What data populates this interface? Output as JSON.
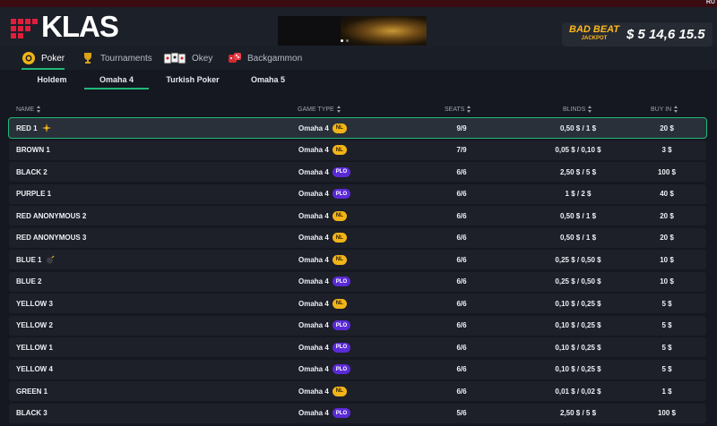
{
  "top_bar": {
    "language": "RU"
  },
  "header": {
    "logo_text": "KLAS",
    "jackpot": {
      "title": "BAD BEAT",
      "subtitle": "JACKPOT",
      "amount": "$ 5 14,6 15.5"
    }
  },
  "categories": [
    {
      "label": "Poker",
      "icon": "chips-icon",
      "active": true
    },
    {
      "label": "Tournaments",
      "icon": "trophy-icon",
      "active": false
    },
    {
      "label": "Okey",
      "icon": "okey-tiles-icon",
      "active": false
    },
    {
      "label": "Backgammon",
      "icon": "dice-icon",
      "active": false
    }
  ],
  "subtabs": [
    {
      "label": "Holdem",
      "active": false
    },
    {
      "label": "Omaha 4",
      "active": true
    },
    {
      "label": "Turkish Poker",
      "active": false
    },
    {
      "label": "Omaha 5",
      "active": false
    }
  ],
  "table": {
    "columns": {
      "name": "NAME",
      "game_type": "GAME TYPE",
      "seats": "SEATS",
      "blinds": "BLINDS",
      "buy_in": "BUY IN"
    },
    "rows": [
      {
        "name": "RED 1",
        "game": "Omaha 4",
        "limit": "NL",
        "seats": "9/9",
        "blinds": "0,50 $ / 1 $",
        "buy_in": "20 $",
        "icon": "sparkle-icon",
        "selected": true
      },
      {
        "name": "BROWN 1",
        "game": "Omaha 4",
        "limit": "NL",
        "seats": "7/9",
        "blinds": "0,05 $ / 0,10 $",
        "buy_in": "3 $"
      },
      {
        "name": "BLACK 2",
        "game": "Omaha 4",
        "limit": "PLO",
        "seats": "6/6",
        "blinds": "2,50 $ / 5 $",
        "buy_in": "100 $"
      },
      {
        "name": "PURPLE 1",
        "game": "Omaha 4",
        "limit": "PLO",
        "seats": "6/6",
        "blinds": "1 $ / 2 $",
        "buy_in": "40 $"
      },
      {
        "name": "RED ANONYMOUS 2",
        "game": "Omaha 4",
        "limit": "NL",
        "seats": "6/6",
        "blinds": "0,50 $ / 1 $",
        "buy_in": "20 $"
      },
      {
        "name": "RED ANONYMOUS 3",
        "game": "Omaha 4",
        "limit": "NL",
        "seats": "6/6",
        "blinds": "0,50 $ / 1 $",
        "buy_in": "20 $"
      },
      {
        "name": "BLUE 1",
        "game": "Omaha 4",
        "limit": "NL",
        "seats": "6/6",
        "blinds": "0,25 $ / 0,50 $",
        "buy_in": "10 $",
        "icon": "bomb-icon"
      },
      {
        "name": "BLUE 2",
        "game": "Omaha 4",
        "limit": "PLO",
        "seats": "6/6",
        "blinds": "0,25 $ / 0,50 $",
        "buy_in": "10 $"
      },
      {
        "name": "YELLOW 3",
        "game": "Omaha 4",
        "limit": "NL",
        "seats": "6/6",
        "blinds": "0,10 $ / 0,25 $",
        "buy_in": "5 $"
      },
      {
        "name": "YELLOW 2",
        "game": "Omaha 4",
        "limit": "PLO",
        "seats": "6/6",
        "blinds": "0,10 $ / 0,25 $",
        "buy_in": "5 $"
      },
      {
        "name": "YELLOW 1",
        "game": "Omaha 4",
        "limit": "PLO",
        "seats": "6/6",
        "blinds": "0,10 $ / 0,25 $",
        "buy_in": "5 $"
      },
      {
        "name": "YELLOW 4",
        "game": "Omaha 4",
        "limit": "PLO",
        "seats": "6/6",
        "blinds": "0,10 $ / 0,25 $",
        "buy_in": "5 $"
      },
      {
        "name": "GREEN 1",
        "game": "Omaha 4",
        "limit": "NL",
        "seats": "6/6",
        "blinds": "0,01 $ / 0,02 $",
        "buy_in": "1 $"
      },
      {
        "name": "BLACK 3",
        "game": "Omaha 4",
        "limit": "PLO",
        "seats": "5/6",
        "blinds": "2,50 $ / 5 $",
        "buy_in": "100 $"
      }
    ]
  },
  "colors": {
    "accent": "#1fb978",
    "nl_badge": "#f2b418",
    "plo_badge": "#5b2ad8",
    "brand_red": "#e01e3c",
    "jackpot_gold": "#ffb81c"
  }
}
